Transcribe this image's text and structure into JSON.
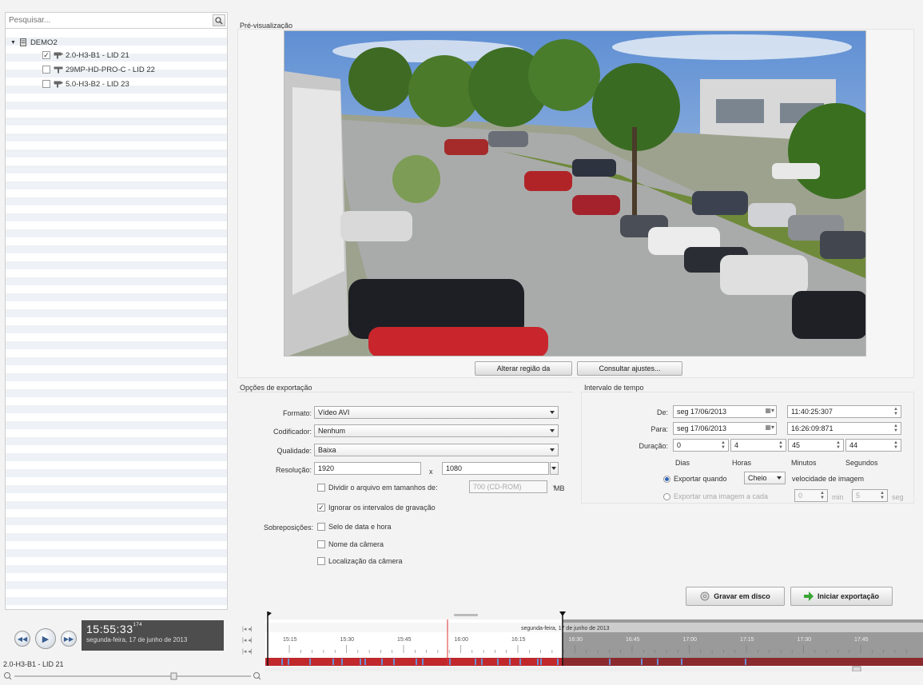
{
  "search": {
    "placeholder": "Pesquisar..."
  },
  "tree": {
    "site": "DEMO2",
    "cameras": [
      {
        "label": "2.0-H3-B1 - LID 21",
        "checked": true
      },
      {
        "label": "29MP-HD-PRO-C - LID 22",
        "checked": false
      },
      {
        "label": "5.0-H3-B2 - LID 23",
        "checked": false
      }
    ]
  },
  "player": {
    "time": "15:55:33",
    "time_ms": "174",
    "date": "segunda-feira, 17 de junho de 2013",
    "camera": "2.0-H3-B1 - LID 21"
  },
  "preview": {
    "title": "Pré-visualização",
    "change_region_button": "Alterar região da",
    "consult_settings_button": "Consultar ajustes..."
  },
  "export_options": {
    "title": "Opções de exportação",
    "format_label": "Formato:",
    "format_value": "Vídeo AVI",
    "codec_label": "Codificador:",
    "codec_value": "Nenhum",
    "quality_label": "Qualidade:",
    "quality_value": "Baixa",
    "resolution_label": "Resolução:",
    "resolution_width": "1920",
    "resolution_x": "x",
    "resolution_height": "1080",
    "split_label": "Dividir o arquivo em tamanhos de:",
    "split_value": "700 (CD-ROM)",
    "split_unit": "MB",
    "ignore_gaps_label": "Ignorar os intervalos de gravação",
    "overlays_label": "Sobreposições:",
    "overlay_datetime": "Selo de data e hora",
    "overlay_name": "Nome da câmera",
    "overlay_location": "Localização da câmera"
  },
  "time_range": {
    "title": "Intervalo de tempo",
    "from_label": "De:",
    "from_date": "seg 17/06/2013",
    "from_time": "11:40:25:307",
    "to_label": "Para:",
    "to_date": "seg 17/06/2013",
    "to_time": "16:26:09:871",
    "duration_label": "Duração:",
    "days": "0",
    "hours": "4",
    "minutes": "45",
    "seconds": "44",
    "days_label": "Dias",
    "hours_label": "Horas",
    "minutes_label": "Minutos",
    "seconds_label": "Segundos",
    "export_when_label": "Exportar quando",
    "export_when_value": "Cheio",
    "frame_rate_label": "velocidade de imagem",
    "export_every_label": "Exportar uma imagem a cada",
    "every_min": "0",
    "min_label": "min",
    "every_sec": "5",
    "sec_label": "seg"
  },
  "actions": {
    "burn_button": "Gravar em disco",
    "start_button": "Iniciar exportação"
  },
  "timeline": {
    "date_label": "segunda-feira, 17 de junho de 2013",
    "ticks": [
      "15:15",
      "15:30",
      "15:45",
      "16:00",
      "16:15",
      "16:30",
      "16:45",
      "17:00",
      "17:15",
      "17:30",
      "17:45"
    ]
  },
  "colors": {
    "accent": "#2f63b5",
    "recording": "#c0282c",
    "motion": "#6a8fd6",
    "start_arrow": "#3aa535"
  }
}
